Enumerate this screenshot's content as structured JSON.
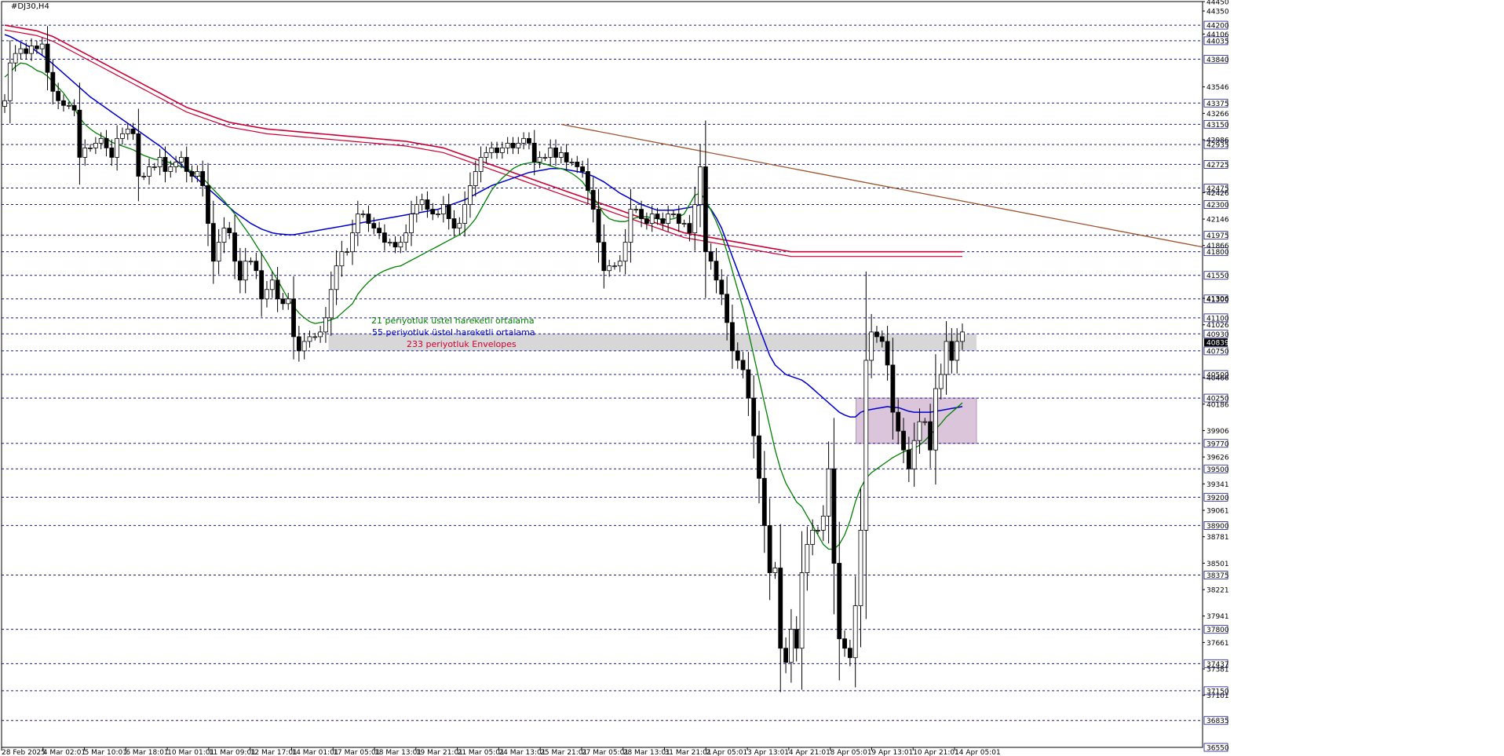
{
  "window": {
    "title": "#DJ30,H4"
  },
  "chart_data": {
    "type": "candlestick",
    "symbol": "#DJ30",
    "timeframe": "H4",
    "ylim": [
      36550,
      44450
    ],
    "y_tick_labels": [
      44450,
      44350,
      44106,
      43546,
      43266,
      42986,
      42426,
      42146,
      41866,
      41306,
      41026,
      40466,
      40186,
      39906,
      39626,
      39341,
      39061,
      38781,
      38501,
      38221,
      37941,
      37661,
      37381,
      37101
    ],
    "level_labels": [
      44200,
      44035,
      43840,
      43375,
      43150,
      42935,
      42725,
      42475,
      42300,
      41975,
      41800,
      41550,
      41300,
      41100,
      40930,
      40750,
      40500,
      40250,
      39770,
      39500,
      39200,
      38900,
      38375,
      37800,
      37437,
      37150,
      36835,
      36550
    ],
    "current_price": 40839,
    "x_tick_labels": [
      "28 Feb 2025",
      "4 Mar 02:01",
      "5 Mar 10:01",
      "6 Mar 18:01",
      "10 Mar 01:01",
      "11 Mar 09:01",
      "12 Mar 17:01",
      "14 Mar 01:01",
      "17 Mar 05:01",
      "18 Mar 13:01",
      "19 Mar 21:01",
      "21 Mar 05:01",
      "24 Mar 13:01",
      "25 Mar 21:01",
      "27 Mar 05:01",
      "28 Mar 13:01",
      "31 Mar 21:01",
      "2 Apr 05:01",
      "3 Apr 13:01",
      "4 Apr 21:01",
      "8 Apr 05:01",
      "9 Apr 13:01",
      "10 Apr 21:01",
      "14 Apr 05:01"
    ],
    "candles_close": [
      43400,
      43800,
      43900,
      43950,
      43900,
      43980,
      43950,
      44000,
      43700,
      43500,
      43400,
      43350,
      43350,
      43300,
      42800,
      42900,
      42900,
      42950,
      43000,
      42900,
      42800,
      43000,
      43050,
      43100,
      43050,
      42600,
      42600,
      42700,
      42700,
      42800,
      42650,
      42700,
      42750,
      42800,
      42650,
      42600,
      42650,
      42500,
      42100,
      41700,
      41900,
      42050,
      42000,
      41700,
      41500,
      41700,
      41700,
      41600,
      41300,
      41400,
      41500,
      41300,
      41250,
      41300,
      40900,
      40750,
      40850,
      40900,
      40900,
      40950,
      41100,
      41400,
      41650,
      41800,
      41800,
      42000,
      42200,
      42200,
      42100,
      42050,
      42000,
      41900,
      41900,
      41850,
      41900,
      42000,
      42200,
      42300,
      42350,
      42250,
      42200,
      42200,
      42300,
      42150,
      42050,
      42100,
      42300,
      42500,
      42650,
      42800,
      42850,
      42900,
      42850,
      42900,
      42950,
      42900,
      42950,
      43000,
      42950,
      42750,
      42800,
      42800,
      42900,
      42800,
      42850,
      42750,
      42750,
      42700,
      42650,
      42450,
      42250,
      41900,
      41600,
      41650,
      41650,
      41700,
      41900,
      42250,
      42250,
      42150,
      42100,
      42200,
      42150,
      42100,
      42200,
      42200,
      42100,
      42100,
      42000,
      42300,
      42700,
      41800,
      41700,
      41500,
      41350,
      41050,
      40750,
      40650,
      40550,
      40250,
      39850,
      39400,
      38900,
      38400,
      38450,
      37600,
      37450,
      37800,
      37600,
      38400,
      38700,
      38850,
      38850,
      39000,
      39500,
      38500,
      37700,
      37600,
      37500,
      38050,
      38850,
      40650,
      40950,
      40900,
      40850,
      40600,
      40100,
      39900,
      39700,
      39500,
      39800,
      40000,
      40000,
      39700,
      40350,
      40500,
      40850,
      40650,
      40850,
      40950
    ],
    "ema21": [
      43650,
      43700,
      43760,
      43800,
      43790,
      43760,
      43720,
      43700,
      43660,
      43600,
      43540,
      43480,
      43400,
      43320,
      43220,
      43150,
      43100,
      43060,
      43030,
      43000,
      42960,
      42940,
      42920,
      42900,
      42880,
      42850,
      42820,
      42800,
      42780,
      42770,
      42760,
      42740,
      42720,
      42700,
      42680,
      42650,
      42620,
      42580,
      42520,
      42460,
      42400,
      42340,
      42270,
      42200,
      42120,
      42040,
      41960,
      41870,
      41780,
      41690,
      41590,
      41500,
      41400,
      41300,
      41220,
      41150,
      41100,
      41060,
      41040,
      41050,
      41060,
      41080,
      41100,
      41150,
      41200,
      41250,
      41350,
      41420,
      41480,
      41530,
      41570,
      41600,
      41620,
      41640,
      41650,
      41680,
      41710,
      41740,
      41770,
      41800,
      41830,
      41860,
      41890,
      41920,
      41950,
      41980,
      42020,
      42080,
      42150,
      42250,
      42350,
      42450,
      42520,
      42580,
      42630,
      42680,
      42710,
      42730,
      42740,
      42750,
      42740,
      42730,
      42710,
      42690,
      42680,
      42660,
      42630,
      42590,
      42540,
      42460,
      42380,
      42290,
      42200,
      42150,
      42130,
      42120,
      42120,
      42140,
      42160,
      42170,
      42170,
      42160,
      42150,
      42140,
      42140,
      42150,
      42170,
      42200,
      42300,
      42400,
      42420,
      42350,
      42240,
      42120,
      41980,
      41800,
      41600,
      41400,
      41200,
      40950,
      40700,
      40450,
      40200,
      39950,
      39700,
      39500,
      39350,
      39250,
      39150,
      39100,
      39000,
      38900,
      38800,
      38700,
      38650,
      38650,
      38700,
      38800,
      38950,
      39150,
      39300,
      39400,
      39460,
      39500,
      39540,
      39580,
      39620,
      39650,
      39680,
      39700,
      39720,
      39750,
      39800,
      39860,
      39920,
      39980,
      40050,
      40100,
      40150,
      40200
    ],
    "ema55": [
      44100,
      44080,
      44050,
      44020,
      43990,
      43960,
      43920,
      43880,
      43840,
      43790,
      43740,
      43690,
      43640,
      43590,
      43540,
      43490,
      43440,
      43400,
      43360,
      43320,
      43280,
      43240,
      43200,
      43160,
      43120,
      43080,
      43040,
      43000,
      42960,
      42920,
      42870,
      42820,
      42770,
      42720,
      42670,
      42620,
      42570,
      42520,
      42470,
      42420,
      42370,
      42320,
      42270,
      42220,
      42180,
      42140,
      42100,
      42070,
      42040,
      42020,
      42000,
      41990,
      41985,
      41980,
      41980,
      41990,
      42000,
      42010,
      42020,
      42030,
      42040,
      42050,
      42060,
      42070,
      42080,
      42090,
      42100,
      42110,
      42120,
      42130,
      42140,
      42150,
      42160,
      42170,
      42180,
      42190,
      42200,
      42210,
      42220,
      42230,
      42240,
      42250,
      42270,
      42290,
      42310,
      42330,
      42350,
      42380,
      42410,
      42440,
      42470,
      42500,
      42520,
      42540,
      42560,
      42580,
      42600,
      42620,
      42640,
      42650,
      42660,
      42670,
      42680,
      42680,
      42680,
      42670,
      42660,
      42650,
      42640,
      42620,
      42600,
      42570,
      42540,
      42500,
      42460,
      42420,
      42390,
      42360,
      42330,
      42300,
      42280,
      42260,
      42240,
      42240,
      42240,
      42240,
      42250,
      42260,
      42270,
      42280,
      42300,
      42300,
      42250,
      42160,
      42050,
      41900,
      41750,
      41600,
      41450,
      41300,
      41150,
      41000,
      40850,
      40700,
      40600,
      40550,
      40500,
      40480,
      40460,
      40440,
      40400,
      40350,
      40300,
      40250,
      40200,
      40150,
      40100,
      40070,
      40050,
      40050,
      40100,
      40120,
      40130,
      40140,
      40150,
      40160,
      40150,
      40150,
      40130,
      40110,
      40100,
      40100,
      40100,
      40100,
      40110,
      40120,
      40130,
      40140,
      40150,
      40160
    ],
    "envelope_upper": [
      44200,
      44190,
      44180,
      44170,
      44160,
      44150,
      44140,
      44120,
      44100,
      44080,
      44050,
      44020,
      43990,
      43960,
      43930,
      43900,
      43870,
      43840,
      43810,
      43780,
      43750,
      43720,
      43690,
      43660,
      43630,
      43600,
      43570,
      43540,
      43510,
      43480,
      43450,
      43420,
      43390,
      43360,
      43330,
      43310,
      43290,
      43270,
      43250,
      43230,
      43210,
      43190,
      43170,
      43160,
      43150,
      43140,
      43130,
      43120,
      43110,
      43100,
      43095,
      43090,
      43085,
      43080,
      43075,
      43070,
      43065,
      43060,
      43055,
      43050,
      43045,
      43040,
      43035,
      43030,
      43025,
      43020,
      43015,
      43010,
      43005,
      43000,
      42995,
      42990,
      42985,
      42980,
      42975,
      42970,
      42960,
      42950,
      42940,
      42930,
      42920,
      42910,
      42900,
      42880,
      42860,
      42840,
      42820,
      42800,
      42780,
      42760,
      42740,
      42720,
      42700,
      42680,
      42660,
      42640,
      42620,
      42600,
      42580,
      42560,
      42540,
      42520,
      42500,
      42480,
      42460,
      42440,
      42420,
      42400,
      42380,
      42360,
      42340,
      42320,
      42300,
      42280,
      42260,
      42240,
      42220,
      42200,
      42180,
      42160,
      42140,
      42120,
      42100,
      42080,
      42060,
      42040,
      42020,
      42000,
      41990,
      41980,
      41970,
      41960,
      41950,
      41940,
      41930,
      41920,
      41910,
      41900,
      41890,
      41880,
      41870,
      41860,
      41850,
      41840,
      41830,
      41820,
      41810,
      41800,
      41800,
      41800,
      41800,
      41800,
      41800,
      41800,
      41800,
      41800,
      41800,
      41800,
      41800,
      41800,
      41800,
      41800,
      41800,
      41800,
      41800,
      41800,
      41800,
      41800,
      41800,
      41800,
      41800,
      41800,
      41800,
      41800,
      41800,
      41800,
      41800,
      41800,
      41800,
      41800
    ],
    "envelope_lower": [
      44150,
      44140,
      44130,
      44120,
      44110,
      44100,
      44090,
      44070,
      44050,
      44030,
      44000,
      43970,
      43940,
      43910,
      43880,
      43850,
      43820,
      43790,
      43760,
      43730,
      43700,
      43670,
      43640,
      43610,
      43580,
      43550,
      43520,
      43490,
      43460,
      43430,
      43400,
      43370,
      43340,
      43310,
      43280,
      43260,
      43240,
      43220,
      43200,
      43180,
      43160,
      43140,
      43120,
      43110,
      43100,
      43090,
      43080,
      43070,
      43060,
      43050,
      43045,
      43040,
      43035,
      43030,
      43025,
      43020,
      43015,
      43010,
      43005,
      43000,
      42995,
      42990,
      42985,
      42980,
      42975,
      42970,
      42965,
      42960,
      42955,
      42950,
      42945,
      42940,
      42935,
      42930,
      42925,
      42920,
      42910,
      42900,
      42890,
      42880,
      42870,
      42860,
      42850,
      42830,
      42810,
      42790,
      42770,
      42750,
      42730,
      42710,
      42690,
      42670,
      42650,
      42630,
      42610,
      42590,
      42570,
      42550,
      42530,
      42510,
      42490,
      42470,
      42450,
      42430,
      42410,
      42390,
      42370,
      42350,
      42330,
      42310,
      42290,
      42270,
      42250,
      42230,
      42210,
      42190,
      42170,
      42150,
      42130,
      42110,
      42090,
      42070,
      42050,
      42030,
      42010,
      41990,
      41970,
      41950,
      41940,
      41930,
      41920,
      41910,
      41900,
      41890,
      41880,
      41870,
      41860,
      41850,
      41840,
      41830,
      41820,
      41810,
      41800,
      41790,
      41780,
      41770,
      41760,
      41750,
      41750,
      41750,
      41750,
      41750,
      41750,
      41750,
      41750,
      41750,
      41750,
      41750,
      41750,
      41750,
      41750,
      41750,
      41750,
      41750,
      41750,
      41750,
      41750,
      41750,
      41750,
      41750,
      41750,
      41750,
      41750,
      41750,
      41750,
      41750,
      41750,
      41750,
      41750,
      41750
    ],
    "resistance_zone": {
      "from": 40750,
      "to": 40930
    },
    "consolidation_box": {
      "from": 39770,
      "to": 40250
    },
    "trendline": {
      "from": 43150,
      "to": 41850
    },
    "legend": [
      {
        "label": "21 periyotluk üstel hareketli ortalama",
        "color": "#008000"
      },
      {
        "label": "55 periyotluk üstel hareketli ortalama",
        "color": "#0000cc"
      },
      {
        "label": "233 periyotluk Envelopes",
        "color": "#cc0033"
      }
    ],
    "colors": {
      "bull_body": "#ffffff",
      "bear_body": "#000000",
      "ema21": "#008000",
      "ema55": "#0000cc",
      "envelope": "#cc0033",
      "trendline": "#a0522d",
      "level_line": "#1a1a8c",
      "resistance_zone": "#d3d3d3",
      "consolidation_box": "#d8bfd8",
      "price_tag": "#000000"
    },
    "grid": false
  }
}
